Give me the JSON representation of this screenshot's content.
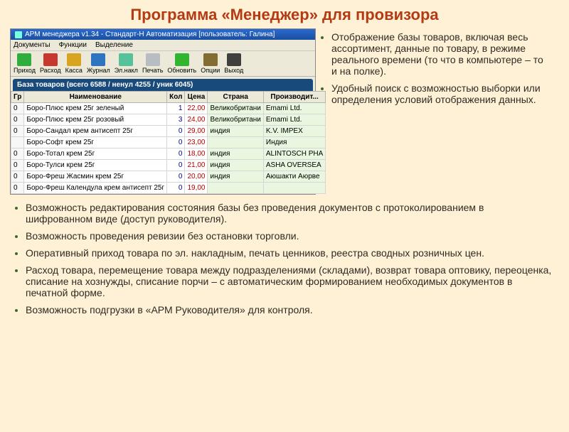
{
  "page_title": "Программа «Менеджер» для провизора",
  "screenshot": {
    "titlebar": "АРМ менеджера v1.34 - Стандарт-Н Автоматизация [пользователь: Галина]",
    "menu": [
      "Документы",
      "Функции",
      "Выделение"
    ],
    "toolbar": [
      {
        "label": "Приход",
        "cls": "green"
      },
      {
        "label": "Расход",
        "cls": "red"
      },
      {
        "label": "Касса",
        "cls": "yellow"
      },
      {
        "label": "Журнал",
        "cls": "blue"
      },
      {
        "label": "Эл.накл",
        "cls": "mint"
      },
      {
        "label": "Печать",
        "cls": "print"
      },
      {
        "label": "Обновить",
        "cls": "refresh"
      },
      {
        "label": "Опции",
        "cls": "gear"
      },
      {
        "label": "Выход",
        "cls": "exit"
      }
    ],
    "tab_label": "База товаров (всего 6588 / ненул 4255 / уник 6045)",
    "columns": [
      "Гр",
      "Наименование",
      "Кол",
      "Цена",
      "Страна",
      "Производит..."
    ],
    "rows": [
      {
        "gr": "0",
        "name": "Боро-Плюс крем 25г зеленый",
        "qty": "1",
        "price": "22,00",
        "country": "Великобритани",
        "mfr": "Emami Ltd."
      },
      {
        "gr": "0",
        "name": "Боро-Плюс крем 25г розовый",
        "qty": "3",
        "price": "24,00",
        "country": "Великобритани",
        "mfr": "Emami Ltd."
      },
      {
        "gr": "0",
        "name": "Боро-Сандал крем антисепт 25г",
        "qty": "0",
        "price": "29,00",
        "country": "индия",
        "mfr": "K.V. IMPEX"
      },
      {
        "gr": "",
        "name": "Боро-Софт крем 25г",
        "qty": "0",
        "price": "23,00",
        "country": "",
        "mfr": "Индия"
      },
      {
        "gr": "0",
        "name": "Боро-Тотал крем 25г",
        "qty": "0",
        "price": "18,00",
        "country": "индия",
        "mfr": "ALINTOSCH PHA"
      },
      {
        "gr": "0",
        "name": "Боро-Тулси крем 25г",
        "qty": "0",
        "price": "21,00",
        "country": "индия",
        "mfr": "ASHA OVERSEA"
      },
      {
        "gr": "0",
        "name": "Боро-Фреш Жасмин крем 25г",
        "qty": "0",
        "price": "20,00",
        "country": "индия",
        "mfr": "Аюшакти Аюрве"
      },
      {
        "gr": "0",
        "name": "Боро-Фреш Календула крем антисепт 25г",
        "qty": "0",
        "price": "19,00",
        "country": "",
        "mfr": ""
      }
    ]
  },
  "side_bullets": [
    "Отображение базы товаров, включая весь ассортимент, данные по товару, в режиме реального времени (то что в компьютере – то и на полке).",
    "Удобный поиск с возможностью выборки или определения условий отображения данных."
  ],
  "lower_bullets": [
    "Возможность редактирования состояния базы без проведения документов с протоколированием в шифрованном виде (доступ руководителя).",
    "Возможность проведения ревизии без остановки торговли.",
    "Оперативный приход товара по эл. накладным, печать ценников, реестра сводных розничных цен.",
    "Расход товара, перемещение товара между подразделениями (складами), возврат товара оптовику, переоценка, списание на хознужды, списание порчи – с автоматическим формированием необходимых документов в печатной форме.",
    "Возможность подгрузки в «АРМ Руководителя» для контроля."
  ]
}
